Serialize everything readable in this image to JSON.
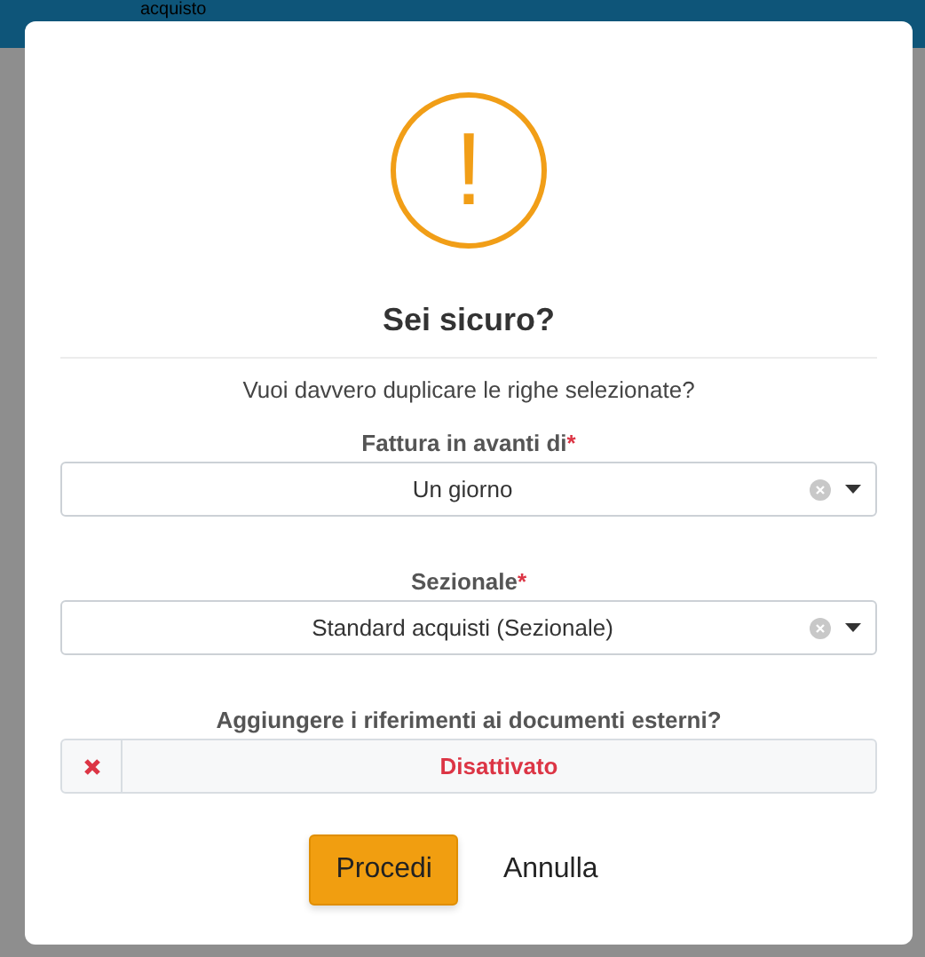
{
  "background": {
    "header_text": "acquisto"
  },
  "dialog": {
    "icon_symbol": "!",
    "title": "Sei sicuro?",
    "message": "Vuoi davvero duplicare le righe selezionate?",
    "fields": [
      {
        "kind": "select",
        "label": "Fattura in avanti di",
        "required_mark": "*",
        "value": "Un giorno"
      },
      {
        "kind": "select",
        "label": "Sezionale",
        "required_mark": "*",
        "value": "Standard acquisti (Sezionale)"
      },
      {
        "kind": "toggle",
        "label": "Aggiungere i riferimenti ai documenti esterni?",
        "on": false,
        "value": "Disattivato"
      }
    ],
    "buttons": [
      {
        "label": "Procedi",
        "kind": "primary"
      },
      {
        "label": "Annulla",
        "kind": "plain"
      }
    ]
  }
}
